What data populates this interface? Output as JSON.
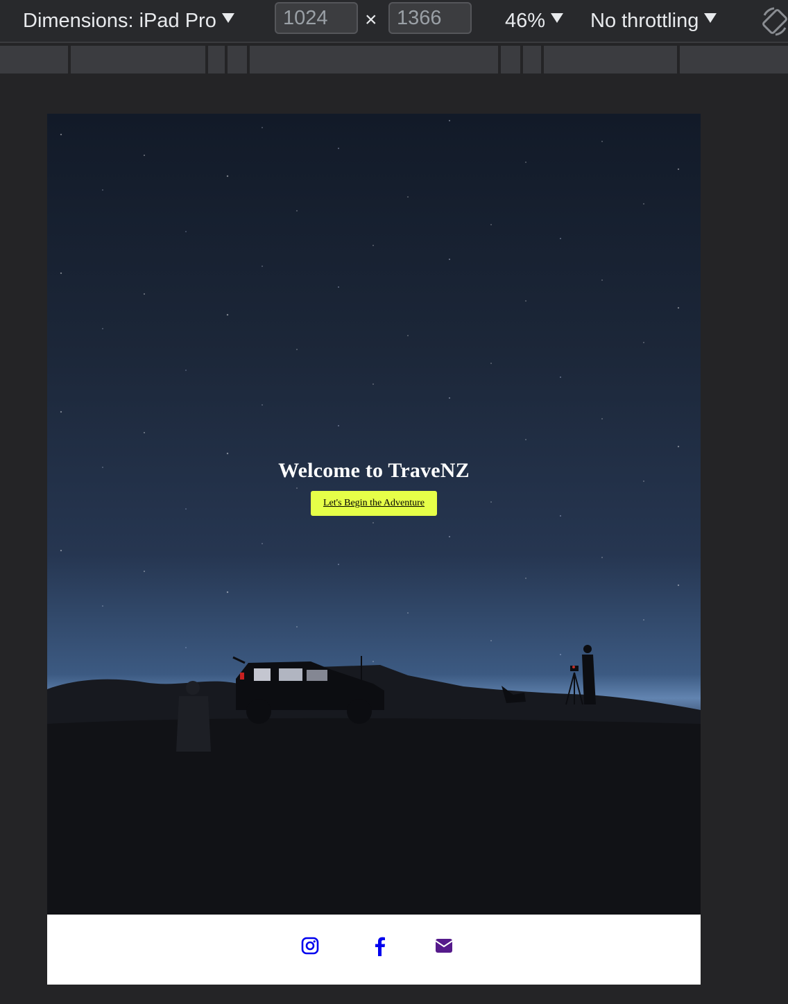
{
  "toolbar": {
    "dimensions_label": "Dimensions: iPad Pro",
    "width_value": "1024",
    "height_value": "1366",
    "times_symbol": "×",
    "zoom": "46%",
    "throttling": "No throttling",
    "icons": [
      "dropdown-caret-icon",
      "rotate-icon"
    ]
  },
  "page": {
    "hero": {
      "title": "Welcome to TraveNZ",
      "button_label": "Let's Begin the Adventure"
    },
    "footer": {
      "social_icons": [
        "instagram-icon",
        "facebook-icon",
        "email-icon"
      ]
    }
  },
  "colors": {
    "cta_background": "#e6ff48",
    "link_blue": "#0000ee",
    "link_visited": "#551a8b",
    "toolbar_bg": "#28292c"
  }
}
